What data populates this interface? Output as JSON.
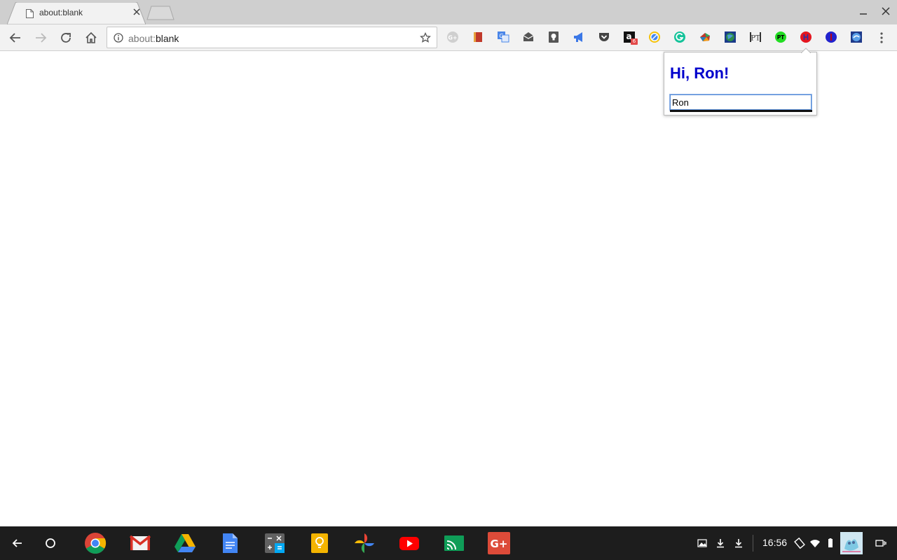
{
  "browser": {
    "tab": {
      "title": "about:blank"
    },
    "omnibox": {
      "scheme": "about:",
      "host": "blank"
    },
    "extensions": [
      {
        "name": "g-plus-ext-icon",
        "badge": ""
      },
      {
        "name": "red-book-ext-icon",
        "badge": ""
      },
      {
        "name": "translate-ext-icon",
        "badge": ""
      },
      {
        "name": "mail-tray-ext-icon",
        "badge": ""
      },
      {
        "name": "lightbulb-ext-icon",
        "badge": ""
      },
      {
        "name": "megaphone-ext-icon",
        "badge": ""
      },
      {
        "name": "pocket-ext-icon",
        "badge": ""
      },
      {
        "name": "amazon-ext-icon",
        "badge": "6"
      },
      {
        "name": "compass-ext-icon",
        "badge": ""
      },
      {
        "name": "grammarly-ext-icon",
        "badge": ""
      },
      {
        "name": "colorful-ball-ext-icon",
        "badge": ""
      },
      {
        "name": "globe-ext-icon",
        "badge": ""
      },
      {
        "name": "pt-ext-icon",
        "badge": ""
      },
      {
        "name": "pt-green-ext-icon",
        "badge": ""
      },
      {
        "name": "hello-red-ext-icon",
        "badge": ""
      },
      {
        "name": "blue-circle-ext-icon",
        "badge": ""
      },
      {
        "name": "blue-square-ext-icon",
        "badge": ""
      }
    ],
    "ext_labels": {
      "amazon": "a",
      "pt": "PT",
      "pt_green": "PT"
    }
  },
  "popup": {
    "greeting": "Hi, Ron!",
    "input_value": "Ron"
  },
  "shelf": {
    "apps": [
      "chrome",
      "gmail",
      "drive",
      "docs",
      "calculator",
      "keep",
      "photos",
      "youtube",
      "sheets-cast",
      "google-plus"
    ],
    "gplus_label": "G+",
    "clock": "16:56"
  },
  "colors": {
    "greeting": "#0000cc",
    "tabstrip": "#cfcfcf",
    "toolbar": "#f2f2f2",
    "shelf": "#1d1d1d"
  }
}
